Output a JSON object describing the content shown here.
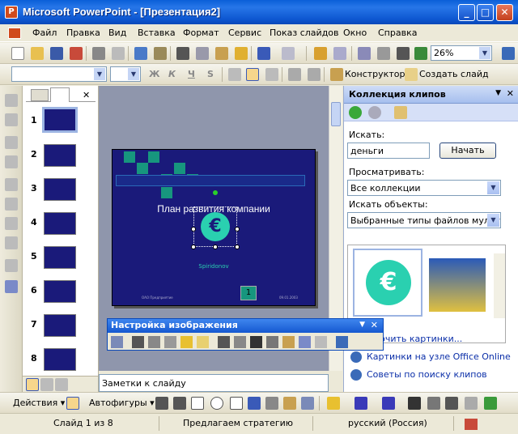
{
  "window": {
    "title": "Microsoft PowerPoint - [Презентация2]",
    "min": "_",
    "max": "□",
    "close": "✕"
  },
  "menu": [
    "Файл",
    "Правка",
    "Вид",
    "Вставка",
    "Формат",
    "Сервис",
    "Показ слайдов",
    "Окно",
    "Справка"
  ],
  "toolbar": {
    "zoom": "26%"
  },
  "format_toolbar": {
    "bold": "Ж",
    "italic": "К",
    "underline": "Ч",
    "shadow": "S",
    "designer": "Конструктор",
    "new_slide": "Создать слайд"
  },
  "slides": {
    "numbers": [
      "1",
      "2",
      "3",
      "4",
      "5",
      "6",
      "7",
      "8"
    ]
  },
  "slide": {
    "title": "План развития компании",
    "subtitle": "Spiridonov",
    "footer_left": "ОАО Предприятие",
    "footer_right": "09.01.2003",
    "page_num": "1",
    "logo": "€"
  },
  "notes": {
    "placeholder": "Заметки к слайду"
  },
  "taskpane": {
    "title": "Коллекция клипов",
    "search_label": "Искать:",
    "search_value": "деньги",
    "search_button": "Начать",
    "browse_label": "Просматривать:",
    "browse_value": "Все коллекции",
    "types_label": "Искать объекты:",
    "types_value": "Выбранные типы файлов мульти",
    "link_organize": "...дочить картинки...",
    "link_online": "Картинки на узле Office Online",
    "link_tips": "Советы по поиску клипов"
  },
  "picture_toolbar": {
    "title": "Настройка изображения"
  },
  "drawbar": {
    "actions": "Действия ▾",
    "autoshapes": "Автофигуры ▾"
  },
  "status": {
    "slide": "Слайд 1 из 8",
    "design": "Предлагаем стратегию",
    "language": "русский (Россия)"
  }
}
